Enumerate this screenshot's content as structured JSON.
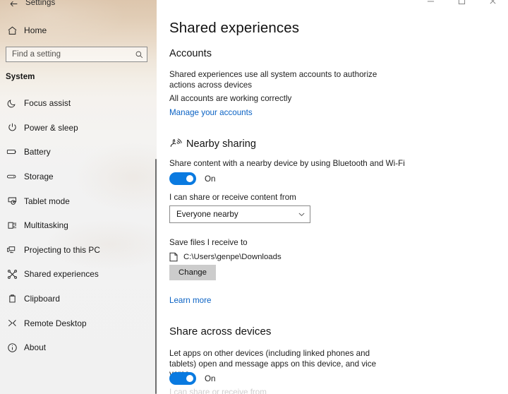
{
  "titlebar": {
    "back_icon": "back-arrow",
    "title": "Settings",
    "minimize": "—",
    "maximize": "☐",
    "close": "✕"
  },
  "sidebar": {
    "home_label": "Home",
    "home_icon": "home-icon",
    "search": {
      "placeholder": "Find a setting",
      "value": "",
      "icon": "search-icon"
    },
    "group_label": "System",
    "items": [
      {
        "label": "Focus assist",
        "icon": "moon-icon"
      },
      {
        "label": "Power & sleep",
        "icon": "power-icon"
      },
      {
        "label": "Battery",
        "icon": "battery-icon"
      },
      {
        "label": "Storage",
        "icon": "storage-icon"
      },
      {
        "label": "Tablet mode",
        "icon": "tablet-icon"
      },
      {
        "label": "Multitasking",
        "icon": "multitasking-icon"
      },
      {
        "label": "Projecting to this PC",
        "icon": "projecting-icon"
      },
      {
        "label": "Shared experiences",
        "icon": "shared-experiences-icon"
      },
      {
        "label": "Clipboard",
        "icon": "clipboard-icon"
      },
      {
        "label": "Remote Desktop",
        "icon": "remote-desktop-icon"
      },
      {
        "label": "About",
        "icon": "info-icon"
      }
    ]
  },
  "main": {
    "page_title": "Shared experiences",
    "accounts": {
      "heading": "Accounts",
      "description": "Shared experiences use all system accounts to authorize actions across devices",
      "status": "All accounts are working correctly",
      "link": "Manage your accounts"
    },
    "nearby_sharing": {
      "heading": "Nearby sharing",
      "icon": "share-broadcast-icon",
      "description": "Share content with a nearby device by using Bluetooth and Wi-Fi",
      "toggle_state": "On",
      "dropdown_label": "I can share or receive content from",
      "dropdown_value": "Everyone nearby",
      "save_label": "Save files I receive to",
      "save_path": "C:\\Users\\genpe\\Downloads",
      "change_button": "Change",
      "learn_more": "Learn more"
    },
    "share_across_devices": {
      "heading": "Share across devices",
      "description": "Let apps on other devices (including linked phones and tablets) open and message apps on this device, and vice versa",
      "toggle_state": "On",
      "cutoff_text": "I can share or receive from"
    }
  },
  "colors": {
    "accent": "#0a7ae0",
    "link": "#0a62c4",
    "sidebar_top": "#ddc6ad",
    "sidebar_bottom": "#f1f1f1"
  }
}
